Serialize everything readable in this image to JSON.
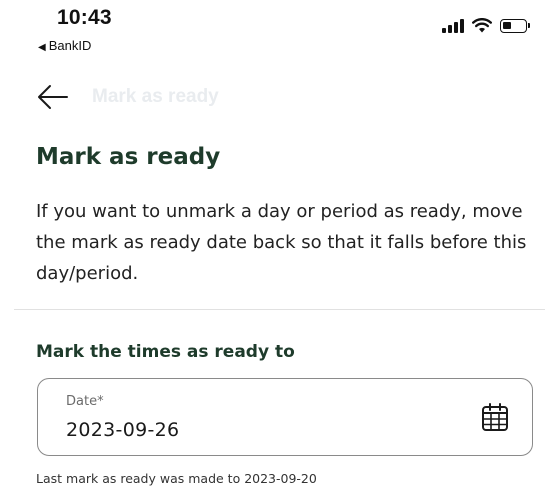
{
  "status_bar": {
    "time": "10:43",
    "back_app_label": "BankID",
    "icons": [
      "back-triangle-icon",
      "signal-icon",
      "wifi-icon",
      "battery-icon"
    ]
  },
  "nav": {
    "title": "Mark as ready",
    "back_icon": "arrow-left-icon"
  },
  "page": {
    "title": "Mark as ready",
    "intro": "If you want to unmark a day or period as ready, move the mark as ready date back so that it falls before this day/period."
  },
  "form": {
    "section_title": "Mark the times as ready to",
    "date_field": {
      "label": "Date*",
      "value": "2023-09-26",
      "icon": "calendar-icon"
    },
    "helper_text": "Last mark as ready was made to 2023-09-20"
  },
  "colors": {
    "heading": "#1e3b2b",
    "nav_title_faint": "#e9ecef",
    "field_border": "#8a8a8a",
    "divider": "#e1e1e1"
  }
}
